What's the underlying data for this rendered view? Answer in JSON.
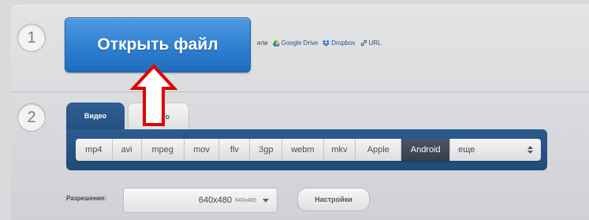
{
  "steps": {
    "one": "1",
    "two": "2"
  },
  "open_button": {
    "label": "Открыть файл"
  },
  "alt_sources": {
    "or": "или",
    "google_drive": "Google Drive",
    "dropbox": "Dropbox",
    "url": "URL"
  },
  "tabs": {
    "video": "Видео",
    "audio": "Аудио"
  },
  "formats": {
    "items": [
      "mp4",
      "avi",
      "mpeg",
      "mov",
      "flv",
      "3gp",
      "webm",
      "mkv",
      "Apple",
      "Android"
    ],
    "active": "Android",
    "more_label": "еще"
  },
  "resolution": {
    "label": "Разрешение:",
    "value": "640x480",
    "value_small": "640x480"
  },
  "settings": {
    "label": "Настройки"
  },
  "colors": {
    "open_button": "#2f7fd0",
    "tab_bar": "#2b5c8f",
    "active_format": "#3d4854",
    "arrow": "#e00000"
  }
}
